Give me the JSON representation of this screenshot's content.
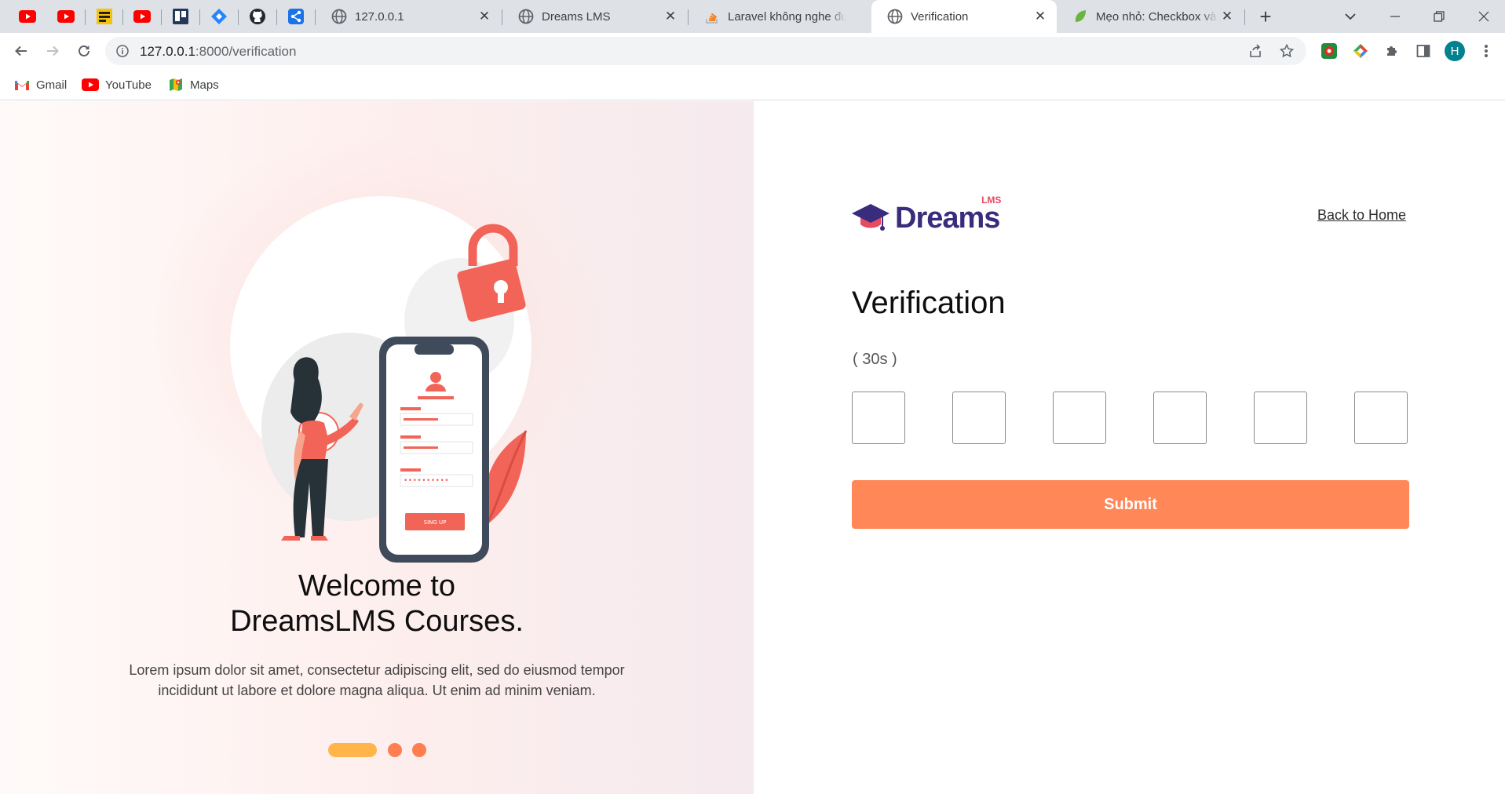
{
  "browser": {
    "tabs": [
      {
        "title": "127.0.0.1",
        "close": "✕"
      },
      {
        "title": "Dreams LMS",
        "close": "✕"
      },
      {
        "title": "Laravel không nghe được",
        "close": "✕"
      },
      {
        "title": "Verification",
        "close": "✕",
        "active": true
      },
      {
        "title": "Mẹo nhỏ: Checkbox và",
        "close": "✕"
      }
    ],
    "pinned_tabs": [
      "youtube-icon",
      "youtube-icon",
      "meme-icon",
      "youtube-icon",
      "trello-icon",
      "jira-icon",
      "github-icon",
      "share-icon"
    ],
    "new_tab": "+",
    "url_host": "127.0.0.1",
    "url_path": ":8000/verification",
    "profile_initial": "H",
    "bookmarks": [
      {
        "label": "Gmail",
        "icon": "gmail-icon"
      },
      {
        "label": "YouTube",
        "icon": "youtube-icon"
      },
      {
        "label": "Maps",
        "icon": "maps-icon"
      }
    ]
  },
  "hero": {
    "title_line1": "Welcome to",
    "title_line2": "DreamsLMS Courses.",
    "description_line1": "Lorem ipsum dolor sit amet, consectetur adipiscing elit, sed do eiusmod tempor",
    "description_line2": "incididunt ut labore et dolore magna aliqua. Ut enim ad minim veniam.",
    "phone_button_text": "SING UP",
    "carousel_slides": 3,
    "carousel_active_index": 0
  },
  "form": {
    "logo_text": "Dreams",
    "logo_badge": "LMS",
    "back_link": "Back to Home",
    "title": "Verification",
    "timer": "( 30s )",
    "otp_values": [
      "",
      "",
      "",
      "",
      "",
      ""
    ],
    "submit_label": "Submit"
  },
  "colors": {
    "accent": "#ff8758",
    "brand_purple": "#392c7d",
    "brand_pink": "#e84a5f",
    "dot_active": "#ffb54a",
    "dot_inactive": "#ff7f50"
  }
}
